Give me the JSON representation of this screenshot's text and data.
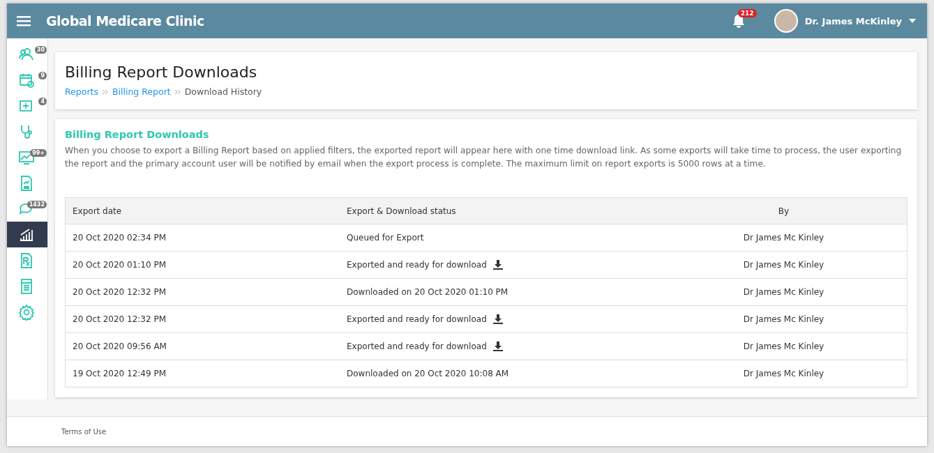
{
  "header": {
    "app_title": "Global Medicare Clinic",
    "notifications": "212",
    "user_name": "Dr. James McKinley"
  },
  "sidebar": {
    "items": [
      {
        "kind": "patients",
        "badge": "30",
        "selected": false
      },
      {
        "kind": "calendar",
        "badge": "9",
        "selected": false
      },
      {
        "kind": "add",
        "badge": "4",
        "selected": false
      },
      {
        "kind": "stethoscope",
        "selected": false
      },
      {
        "kind": "monitor",
        "badge": "99+",
        "selected": false
      },
      {
        "kind": "document",
        "selected": false
      },
      {
        "kind": "chat",
        "badge": "1432",
        "selected": false
      },
      {
        "kind": "reports",
        "selected": true
      },
      {
        "kind": "prescription",
        "selected": false
      },
      {
        "kind": "ledger",
        "selected": false
      },
      {
        "kind": "settings",
        "selected": false
      }
    ]
  },
  "page": {
    "title": "Billing Report Downloads",
    "breadcrumbs": [
      {
        "label": "Reports",
        "link": true
      },
      {
        "label": "Billing Report",
        "link": true
      },
      {
        "label": "Download History",
        "link": false
      }
    ]
  },
  "panel": {
    "title": "Billing Report Downloads",
    "description": "When you choose to export a Billing Report based on applied filters, the exported report will appear here with one time download link. As some exports will take time to process, the user exporting the report and the primary account user will be notified by email when the export process is complete. The maximum limit on report exports is 5000 rows at a time.",
    "table": {
      "columns": [
        "Export date",
        "Export & Download status",
        "By"
      ],
      "rows": [
        {
          "date": "20 Oct 2020 02:34 PM",
          "status": "Queued for Export",
          "download": false,
          "by": "Dr James Mc Kinley"
        },
        {
          "date": "20 Oct 2020 01:10 PM",
          "status": "Exported and ready for download",
          "download": true,
          "by": "Dr James Mc Kinley"
        },
        {
          "date": "20 Oct 2020 12:32 PM",
          "status": "Downloaded on 20 Oct 2020 01:10 PM",
          "download": false,
          "by": "Dr James Mc Kinley"
        },
        {
          "date": "20 Oct 2020 12:32 PM",
          "status": "Exported and ready for download",
          "download": true,
          "by": "Dr James Mc Kinley"
        },
        {
          "date": "20 Oct 2020 09:56 AM",
          "status": "Exported and ready for download",
          "download": true,
          "by": "Dr James Mc Kinley"
        },
        {
          "date": "19 Oct 2020 12:49 PM",
          "status": "Downloaded on 20 Oct 2020 10:08 AM",
          "download": false,
          "by": "Dr James Mc Kinley"
        }
      ]
    }
  },
  "footer": {
    "link": "Terms of Use"
  }
}
